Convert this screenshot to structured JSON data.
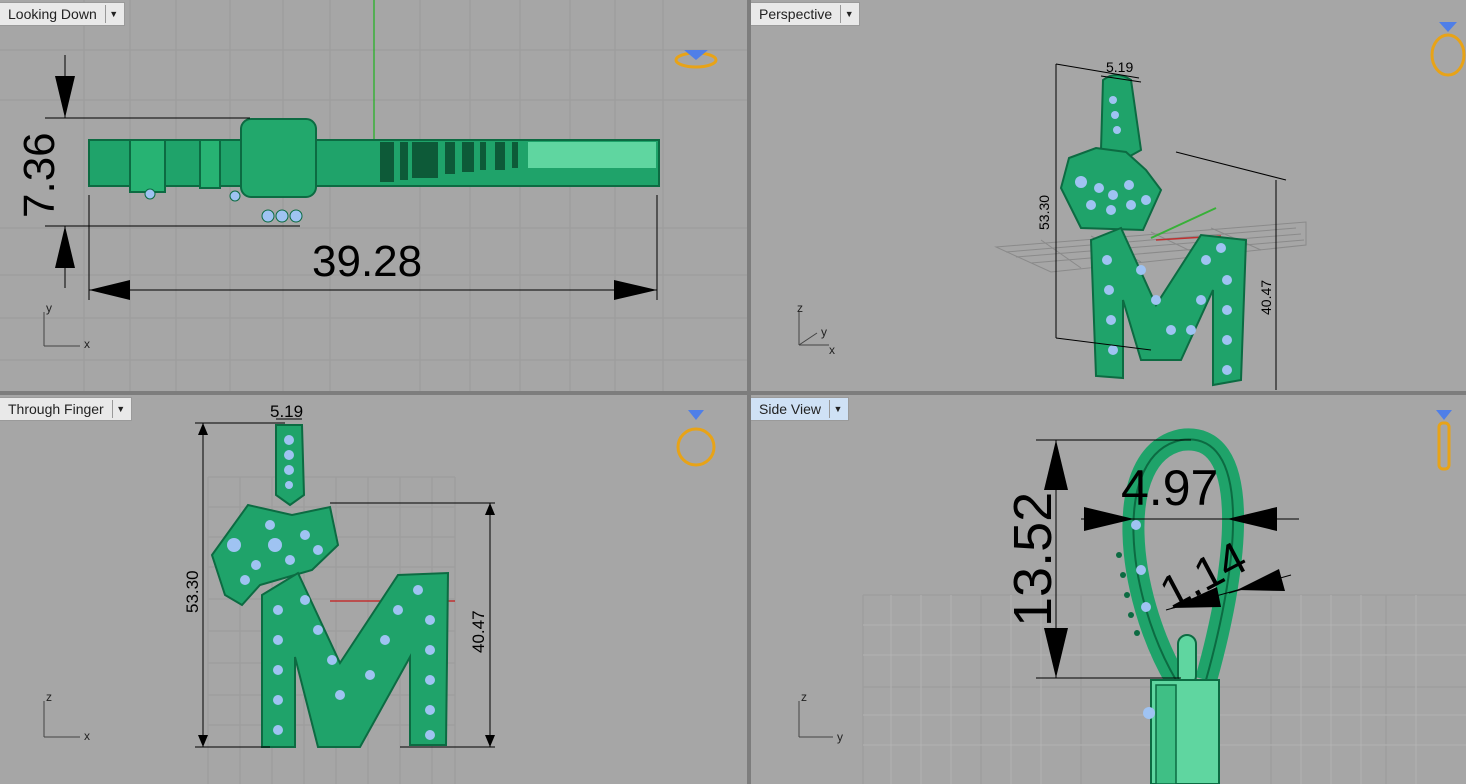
{
  "viewports": [
    {
      "title": "Looking Down",
      "axes": [
        "y",
        "x"
      ],
      "dimensions": [
        "7.36",
        "39.28"
      ]
    },
    {
      "title": "Perspective",
      "axes": [
        "z",
        "y",
        "x"
      ],
      "dimensions": [
        "5.19",
        "53.30",
        "40.47"
      ]
    },
    {
      "title": "Through Finger",
      "axes": [
        "z",
        "x"
      ],
      "dimensions": [
        "5.19",
        "53.30",
        "40.47"
      ]
    },
    {
      "title": "Side View",
      "axes": [
        "z",
        "y"
      ],
      "dimensions": [
        "13.52",
        "4.97",
        "1.14"
      ],
      "active": true
    }
  ],
  "dropdown_icon": "chevron-down-icon",
  "colors": {
    "viewport_bg": "#a6a6a6",
    "grid_line": "#9a9a9a",
    "model_green": "#1fa36a",
    "model_dark": "#0c6b42",
    "gem_blue": "#9fc3f2",
    "widget_gold": "#e8a317",
    "widget_blue": "#4f7fe8",
    "axis_red": "#c03030",
    "axis_green": "#38b038"
  }
}
